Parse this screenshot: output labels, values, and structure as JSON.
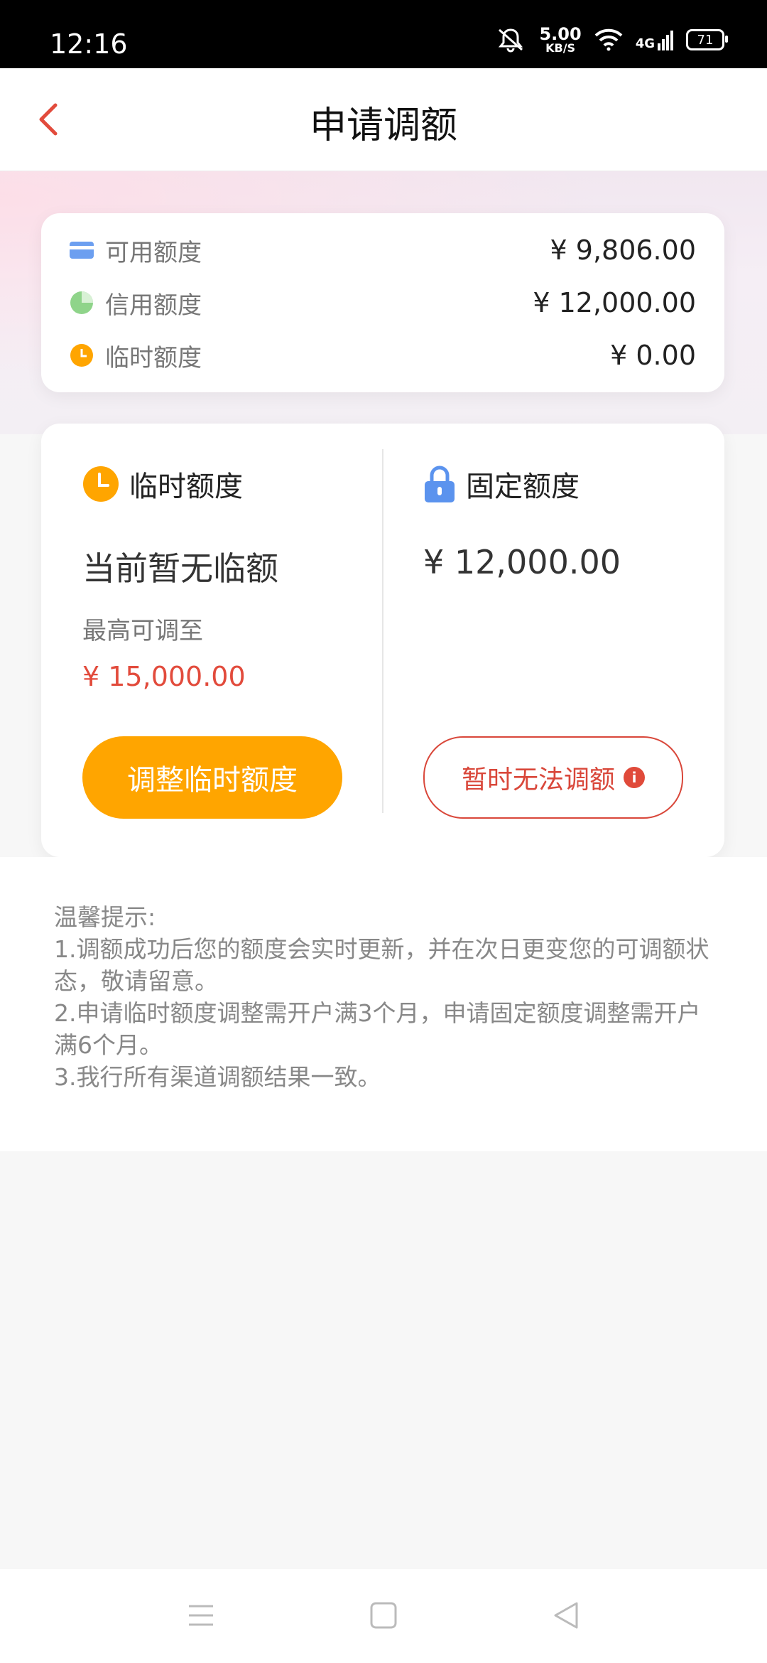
{
  "status": {
    "time": "12:16",
    "speed_value": "5.00",
    "speed_unit": "KB/S",
    "network": "4G",
    "battery": "71"
  },
  "nav": {
    "title": "申请调额"
  },
  "summary": {
    "rows": [
      {
        "label": "可用额度",
        "value": "¥ 9,806.00",
        "icon": "card-icon"
      },
      {
        "label": "信用额度",
        "value": "¥ 12,000.00",
        "icon": "pie-icon"
      },
      {
        "label": "临时额度",
        "value": "¥ 0.00",
        "icon": "clock-icon"
      }
    ]
  },
  "temp": {
    "title": "临时额度",
    "status": "当前暂无临额",
    "max_label": "最高可调至",
    "max_value": "¥ 15,000.00",
    "button": "调整临时额度"
  },
  "fixed": {
    "title": "固定额度",
    "value": "¥ 12,000.00",
    "button": "暂时无法调额"
  },
  "tips": {
    "title": "温馨提示:",
    "items": [
      "1.调额成功后您的额度会实时更新，并在次日更变您的可调额状态，敬请留意。",
      "2.申请临时额度调整需开户满3个月，申请固定额度调整需开户满6个月。",
      "3.我行所有渠道调额结果一致。"
    ]
  },
  "colors": {
    "accent_orange": "#ffa500",
    "accent_red": "#e24b3c",
    "card_blue": "#6c9ff0",
    "pie_green": "#8fd48a"
  }
}
